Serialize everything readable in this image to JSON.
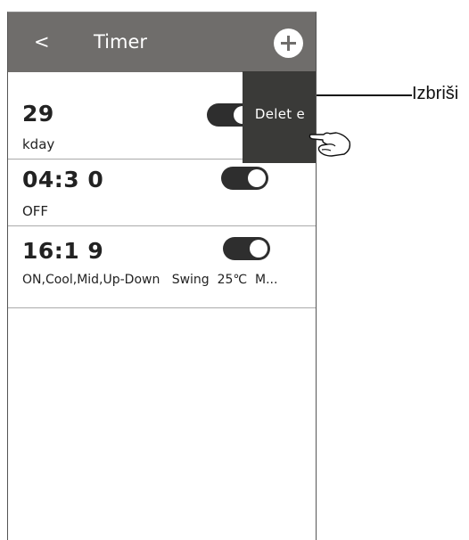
{
  "header": {
    "back_label": "<",
    "title": "Timer",
    "add_label": "+"
  },
  "timers": [
    {
      "time": "29",
      "detail": "kday",
      "enabled": true
    },
    {
      "time": "04:3 0",
      "detail": "OFF",
      "enabled": true
    },
    {
      "time": "16:1 9",
      "detail": "ON,Cool,Mid,Up-Down   Swing  25℃  M...",
      "enabled": true
    }
  ],
  "swipe_action": {
    "delete_label": "Delet e"
  },
  "callout": {
    "label": "Izbriši"
  },
  "colors": {
    "header_bg": "#6f6d6b",
    "delete_bg": "#3a3a38",
    "toggle_on": "#2e2e2e"
  },
  "icons": {
    "add": "plus-icon",
    "pointer": "hand-pointer-icon"
  }
}
